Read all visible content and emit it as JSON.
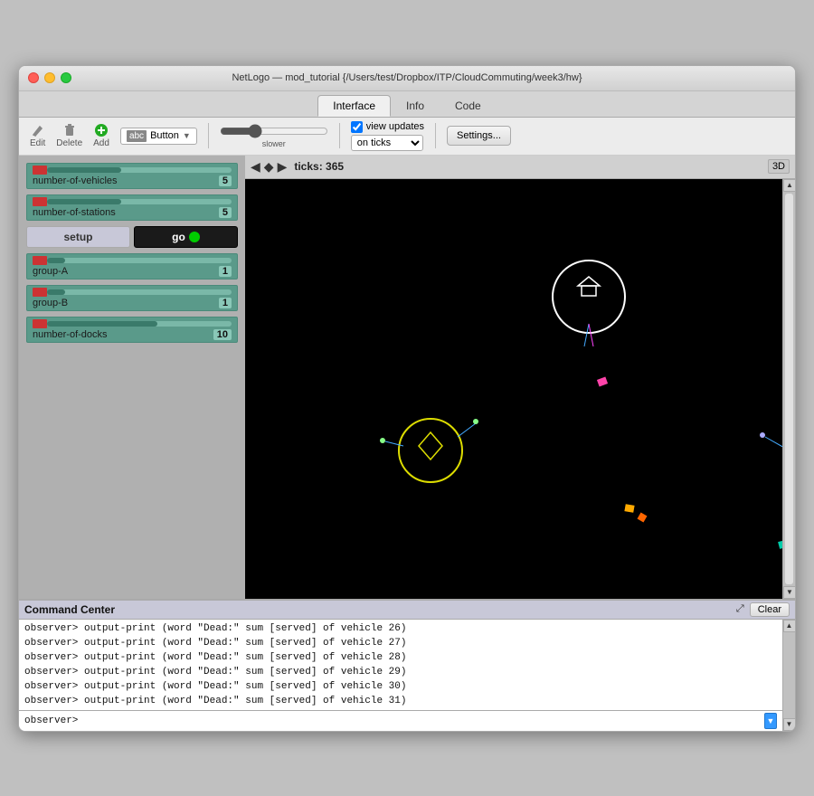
{
  "window": {
    "title": "NetLogo — mod_tutorial {/Users/test/Dropbox/ITP/CloudCommuting/week3/hw}"
  },
  "tabs": [
    {
      "label": "Interface",
      "active": true
    },
    {
      "label": "Info",
      "active": false
    },
    {
      "label": "Code",
      "active": false
    }
  ],
  "toolbar": {
    "edit_label": "Edit",
    "delete_label": "Delete",
    "add_label": "Add",
    "button_dropdown": "Button",
    "speed_label": "slower",
    "view_updates_label": "view updates",
    "on_ticks_label": "on ticks",
    "settings_label": "Settings..."
  },
  "left_panel": {
    "sliders": [
      {
        "label": "number-of-vehicles",
        "value": "5",
        "fill_pct": 40
      },
      {
        "label": "number-of-stations",
        "value": "5",
        "fill_pct": 40
      },
      {
        "label": "group-A",
        "value": "1",
        "fill_pct": 10
      },
      {
        "label": "group-B",
        "value": "1",
        "fill_pct": 10
      },
      {
        "label": "number-of-docks",
        "value": "10",
        "fill_pct": 60
      }
    ],
    "setup_label": "setup",
    "go_label": "go"
  },
  "view": {
    "ticks": "ticks: 365",
    "button_3d": "3D"
  },
  "command_center": {
    "title": "Command Center",
    "clear_label": "Clear",
    "output_lines": [
      "  observer> output-print (word \"Dead:\" sum [served] of vehicle 26)",
      "  observer> output-print (word \"Dead:\" sum [served] of vehicle 27)",
      "  observer> output-print (word \"Dead:\" sum [served] of vehicle 28)",
      "  observer> output-print (word \"Dead:\" sum [served] of vehicle 29)",
      "  observer> output-print (word \"Dead:\" sum [served] of vehicle 30)",
      "  observer> output-print (word \"Dead:\" sum [served] of vehicle 31)"
    ],
    "input_prompt": "observer>"
  }
}
